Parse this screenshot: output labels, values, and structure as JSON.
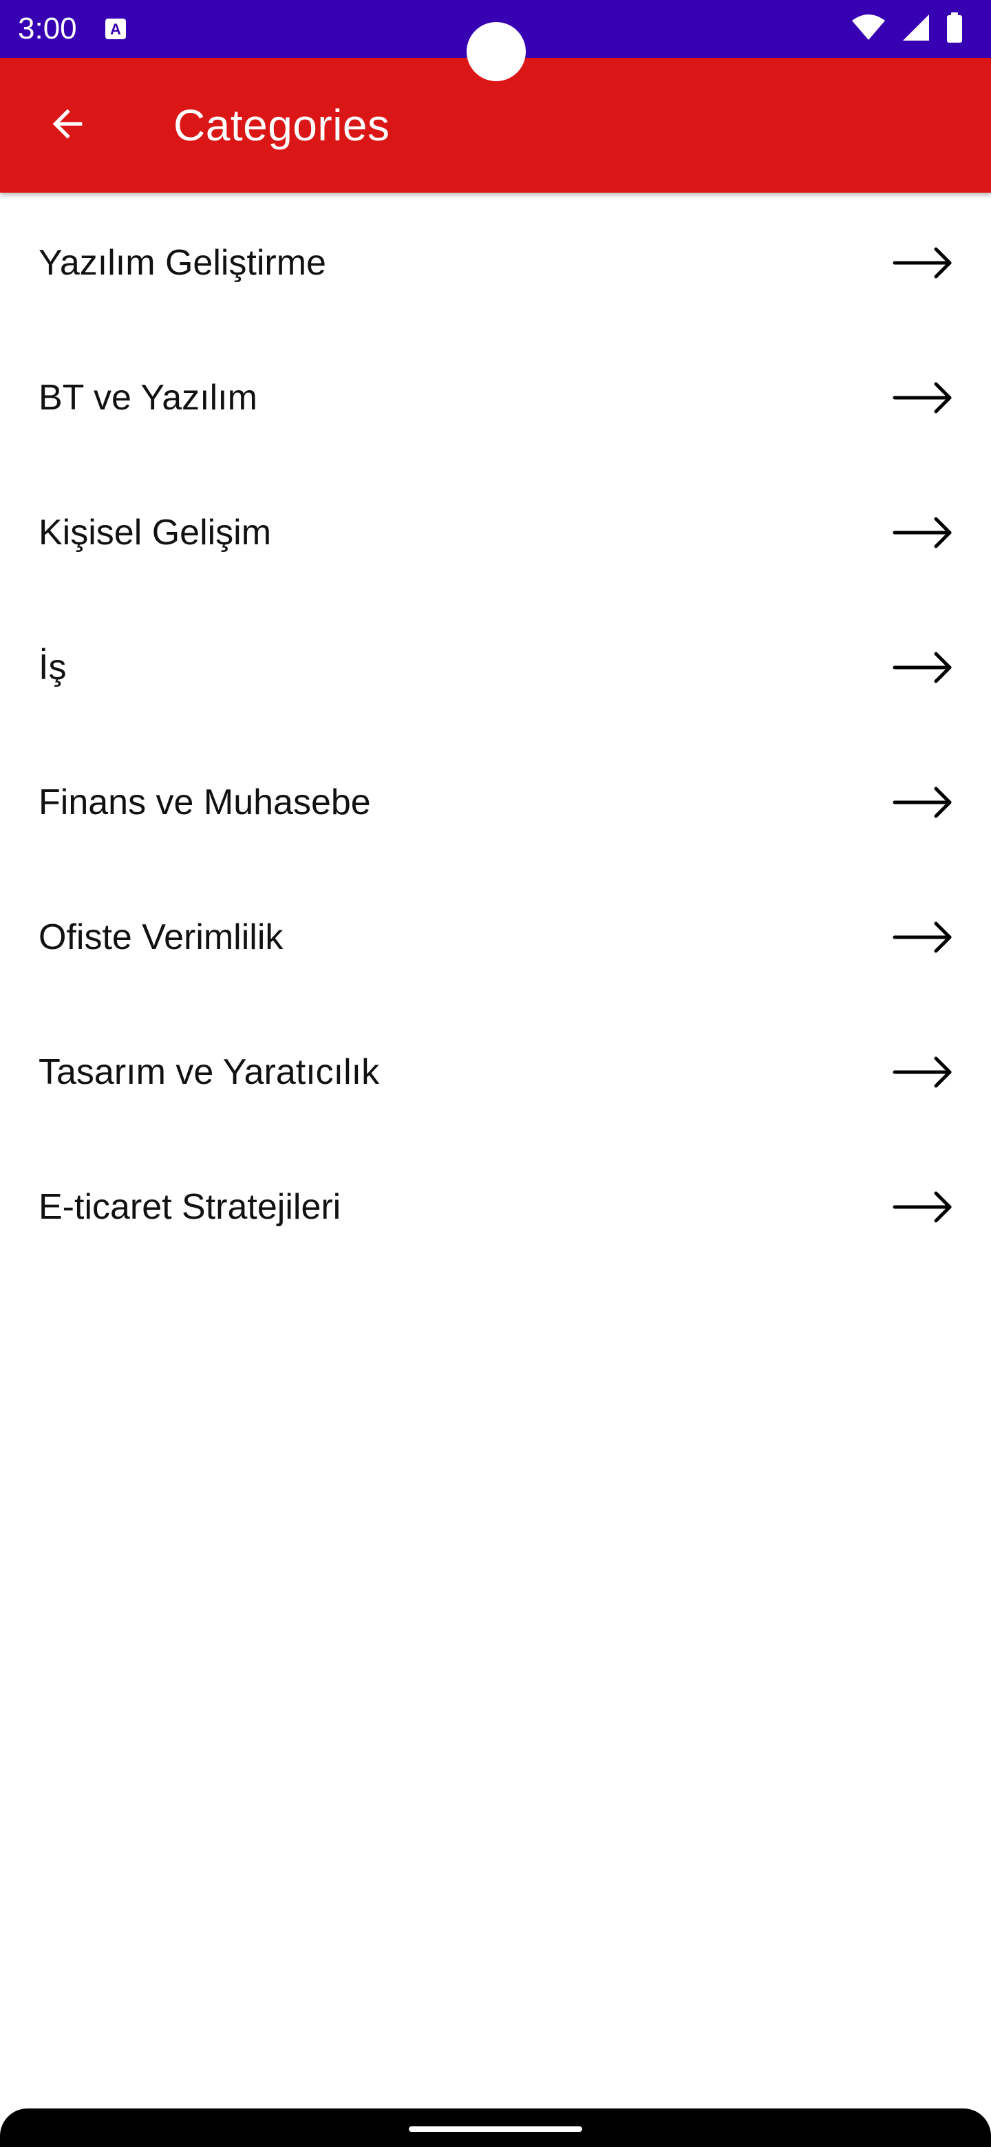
{
  "status_bar": {
    "time": "3:00",
    "color": "#3700b3",
    "icons": [
      "accessibility-a-icon",
      "wifi-icon",
      "cellular-signal-icon",
      "battery-icon"
    ]
  },
  "app_bar": {
    "title": "Categories",
    "color": "#db1616",
    "back_icon": "arrow-back-icon"
  },
  "categories": [
    {
      "label": "Yazılım Geliştirme",
      "icon": "arrow-right-icon"
    },
    {
      "label": "BT ve Yazılım",
      "icon": "arrow-right-icon"
    },
    {
      "label": "Kişisel Gelişim",
      "icon": "arrow-right-icon"
    },
    {
      "label": "İş",
      "icon": "arrow-right-icon"
    },
    {
      "label": "Finans ve Muhasebe",
      "icon": "arrow-right-icon"
    },
    {
      "label": "Ofiste Verimlilik",
      "icon": "arrow-right-icon"
    },
    {
      "label": "Tasarım ve Yaratıcılık",
      "icon": "arrow-right-icon"
    },
    {
      "label": "E-ticaret Stratejileri",
      "icon": "arrow-right-icon"
    }
  ]
}
